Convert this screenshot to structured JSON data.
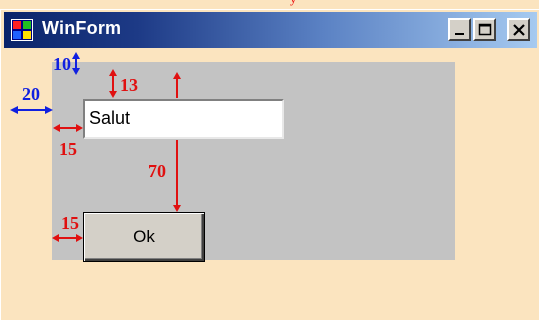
{
  "window": {
    "title": "WinForm",
    "top_text_fragment": "y"
  },
  "controls": {
    "textbox_value": "Salut",
    "ok_label": "Ok"
  },
  "annotations": {
    "margin_left": "20",
    "margin_top": "10",
    "textbox_top": "13",
    "textbox_left": "15",
    "button_gap": "70",
    "button_left": "15"
  },
  "colors": {
    "background": "#fbe4bf",
    "panel": "#c3c3c3",
    "annotation_blue": "#1020e0",
    "annotation_red": "#e01010",
    "titlebar_start": "#0a246a",
    "titlebar_end": "#a6caf0"
  },
  "icons": {
    "app": "windows-app-icon",
    "minimize": "minimize-icon",
    "maximize": "maximize-icon",
    "close": "close-icon"
  }
}
